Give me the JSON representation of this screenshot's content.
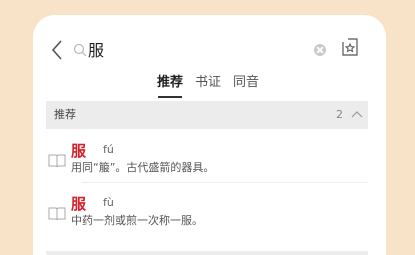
{
  "search": {
    "query": "服"
  },
  "tabs": [
    {
      "label": "推荐",
      "active": true
    },
    {
      "label": "书证",
      "active": false
    },
    {
      "label": "同音",
      "active": false
    }
  ],
  "section": {
    "title": "推荐",
    "count": "2"
  },
  "entries": [
    {
      "char": "服",
      "pinyin": "fú",
      "definition": "用同“箙”。古代盛箭的器具。"
    },
    {
      "char": "服",
      "pinyin": "fù",
      "definition": "中药一剂或煎一次称一服。"
    }
  ],
  "colors": {
    "background": "#f8e2c8",
    "accent": "#d4232b"
  }
}
